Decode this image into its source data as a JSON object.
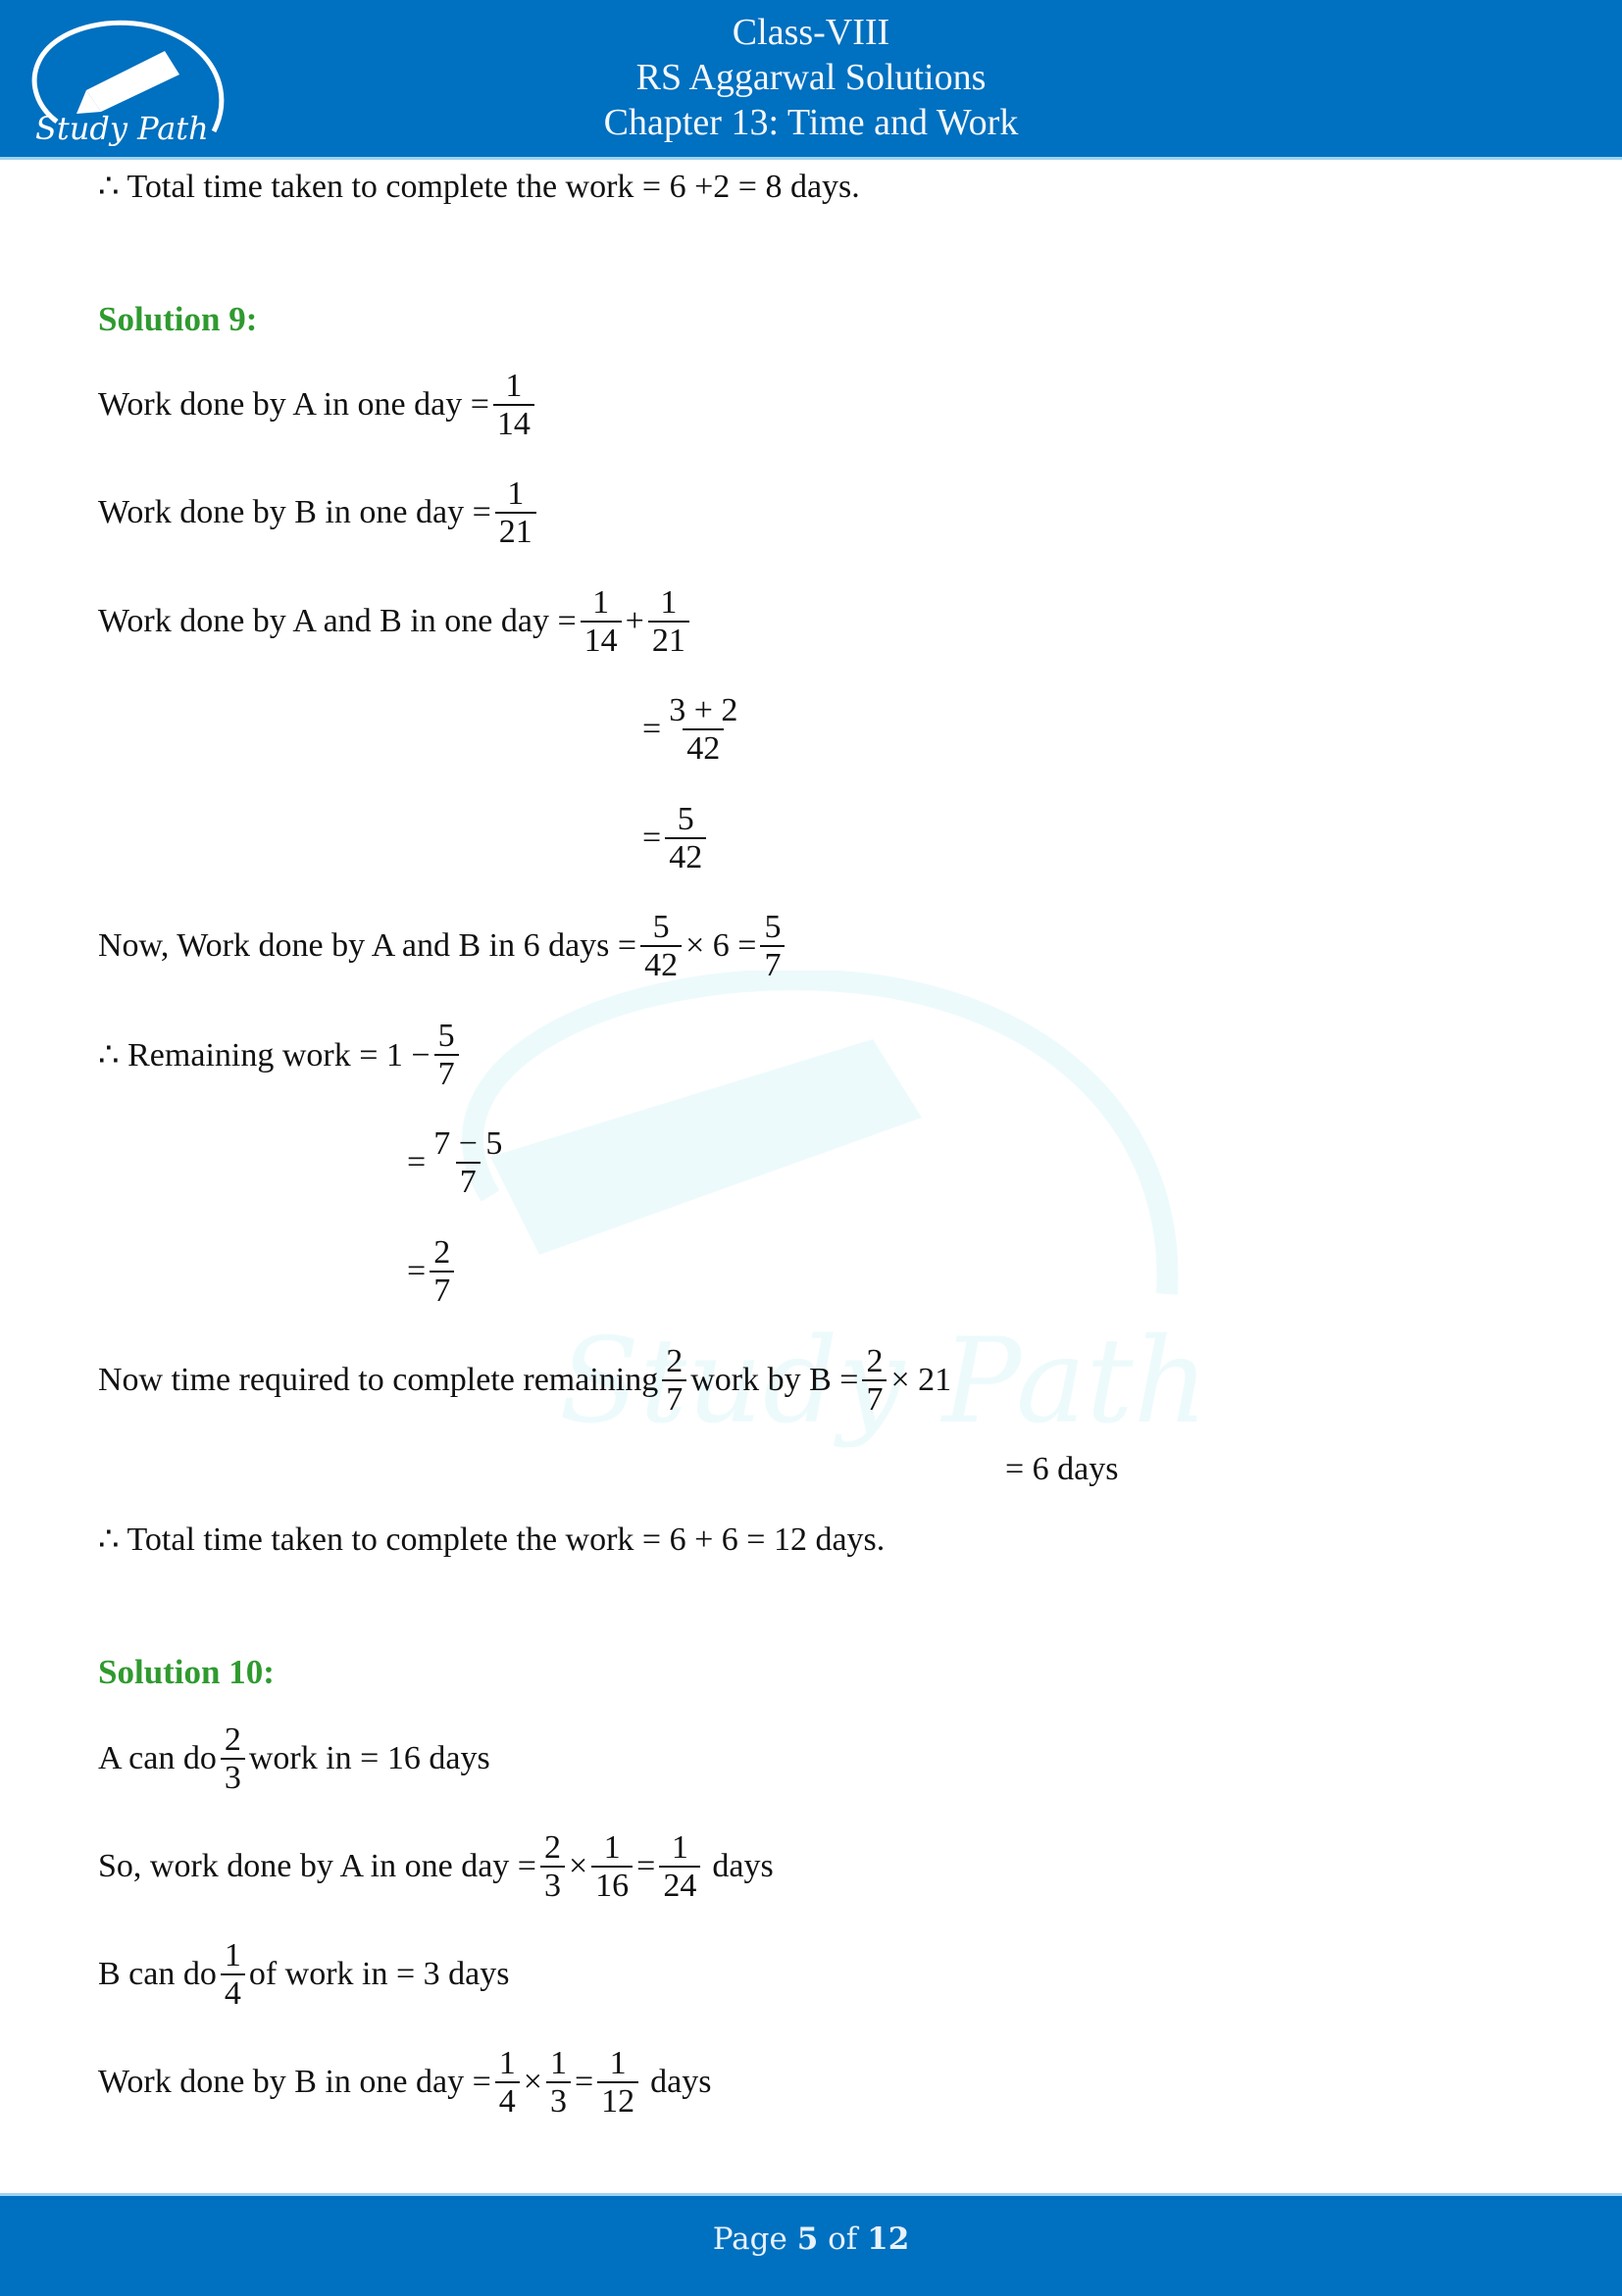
{
  "header": {
    "class": "Class-VIII",
    "book": "RS Aggarwal Solutions",
    "chapter": "Chapter 13: Time and Work",
    "logo_text": "Study Path",
    "logo_icon": "pen-nib-icon"
  },
  "brand_color": "#0070c0",
  "heading_color": "#2f9a2f",
  "content": {
    "prev_total": "∴ Total time taken to complete the work = 6 +2 = 8 days.",
    "solution9": {
      "title": "Solution 9:",
      "a_day": {
        "text": "Work done by A in one day =",
        "num": "1",
        "den": "14"
      },
      "b_day": {
        "text": "Work done by B in one day =",
        "num": "1",
        "den": "21"
      },
      "ab_day": {
        "text": "Work done by A and B in one day =",
        "f1n": "1",
        "f1d": "14",
        "op": "+",
        "f2n": "1",
        "f2d": "21"
      },
      "ab_step2": {
        "eq": "=",
        "num": "3 + 2",
        "den": "42"
      },
      "ab_step3": {
        "eq": "=",
        "num": "5",
        "den": "42"
      },
      "six_days": {
        "text": "Now, Work done by A and B in 6 days =",
        "f1n": "5",
        "f1d": "42",
        "mul": "× 6 =",
        "f2n": "5",
        "f2d": "7"
      },
      "remaining": {
        "text": "∴ Remaining work = 1 −",
        "num": "5",
        "den": "7"
      },
      "rem_step2": {
        "eq": "=",
        "num": "7 − 5",
        "den": "7"
      },
      "rem_step3": {
        "eq": "=",
        "num": "2",
        "den": "7"
      },
      "time_b": {
        "text": "Now time required to complete remaining",
        "f1n": "2",
        "f1d": "7",
        "mid": "work by B =",
        "f2n": "2",
        "f2d": "7",
        "tail": "× 21"
      },
      "time_b_result": "= 6 days",
      "total": "∴ Total time taken to complete the work = 6 + 6 = 12 days."
    },
    "solution10": {
      "title": "Solution 10:",
      "a_can": {
        "pre": "A can do",
        "num": "2",
        "den": "3",
        "post": "work in = 16 days"
      },
      "a_day": {
        "text": "So, work done by A in one day =",
        "f1n": "2",
        "f1d": "3",
        "op": "×",
        "f2n": "1",
        "f2d": "16",
        "eq": "=",
        "f3n": "1",
        "f3d": "24",
        "post": "days"
      },
      "b_can": {
        "pre": "B can do",
        "num": "1",
        "den": "4",
        "post": "of work in = 3 days"
      },
      "b_day": {
        "text": "Work done by B in one day =",
        "f1n": "1",
        "f1d": "4",
        "op": "×",
        "f2n": "1",
        "f2d": "3",
        "eq": "=",
        "f3n": "1",
        "f3d": "12",
        "post": "days"
      }
    }
  },
  "footer": {
    "page_label": "Page",
    "page_current": "5",
    "of_label": "of",
    "page_total": "12"
  }
}
